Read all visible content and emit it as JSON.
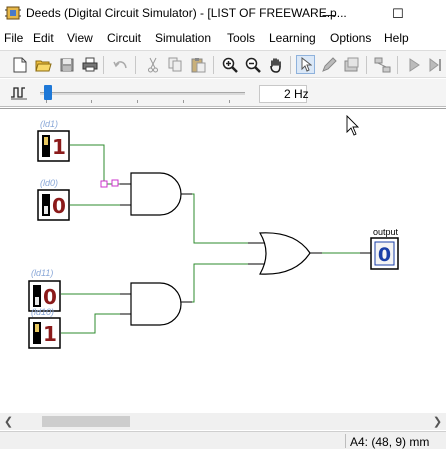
{
  "window": {
    "title": "Deeds (Digital Circuit Simulator) - [LIST OF FREEWARE.p...",
    "min_glyph": "—",
    "max_glyph": "☐"
  },
  "menu": [
    "File",
    "Edit",
    "View",
    "Circuit",
    "Simulation",
    "Tools",
    "Learning",
    "Options",
    "Help"
  ],
  "toolbar": {
    "icons": [
      "new-file-icon",
      "open-folder-icon",
      "save-icon",
      "print-icon",
      "undo-icon",
      "cut-icon",
      "copy-icon",
      "paste-icon",
      "zoom-in-icon",
      "zoom-out-icon",
      "hand-pan-icon",
      "select-arrow-icon",
      "pencil-icon",
      "component-icon",
      "network-icon",
      "play-icon",
      "step-icon"
    ]
  },
  "clock": {
    "frequency": "2 Hz",
    "slider_fraction": 0.02
  },
  "circuit": {
    "inputs": [
      {
        "label": "(ld1)",
        "value": "1"
      },
      {
        "label": "(ld0)",
        "value": "0"
      },
      {
        "label": "(ld11)",
        "value": "0"
      },
      {
        "label": "(ld10)",
        "value": "1"
      }
    ],
    "output": {
      "label": "output",
      "value": "0"
    }
  },
  "colors": {
    "wire": "#2e8b2e",
    "led_on": "#8b1a1a",
    "label_blue": "#8aa8d8",
    "probe": "#cc33cc",
    "output_blue": "#1a3fa8"
  },
  "status": {
    "text": "A4: (48, 9) mm"
  }
}
